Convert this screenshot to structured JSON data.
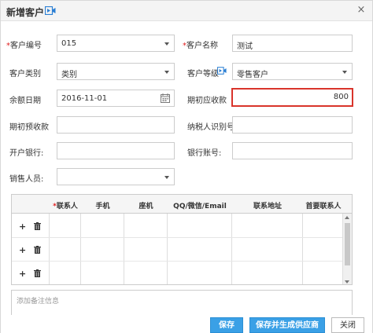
{
  "dialog": {
    "title": "新增客户",
    "close_glyph": "×"
  },
  "form": {
    "customer_code": {
      "label": "客户编号",
      "value": "015"
    },
    "customer_name": {
      "label": "客户名称",
      "value": "测试"
    },
    "customer_type": {
      "label": "客户类别",
      "value": "类别"
    },
    "customer_level": {
      "label": "客户等级",
      "value": "零售客户"
    },
    "balance_date": {
      "label": "余额日期",
      "value": "2016-11-01"
    },
    "opening_receivable": {
      "label": "期初应收款",
      "value": "800"
    },
    "opening_prepaid": {
      "label": "期初预收款",
      "value": ""
    },
    "taxpayer_id": {
      "label": "纳税人识别号:",
      "value": ""
    },
    "bank": {
      "label": "开户银行:",
      "value": ""
    },
    "bank_account": {
      "label": "银行账号:",
      "value": ""
    },
    "salesperson": {
      "label": "销售人员:",
      "value": ""
    },
    "required_mark": "*"
  },
  "grid": {
    "columns": [
      "联系人",
      "手机",
      "座机",
      "QQ/微信/Email",
      "联系地址",
      "首要联系人"
    ],
    "required_mark": "*",
    "row_count": 3,
    "plus_glyph": "+"
  },
  "notes": {
    "placeholder": "添加备注信息"
  },
  "buttons": {
    "save": "保存",
    "save_and_create": "保存并生成供应商",
    "close": "关闭"
  },
  "icons": {
    "title_icon": "video-icon",
    "level_icon": "video-icon",
    "date_icon": "calendar-icon",
    "row_add": "plus-icon",
    "row_delete": "trash-icon"
  },
  "colors": {
    "accent": "#3aa0e6",
    "highlight_border": "#d9342b",
    "required": "#e02020"
  }
}
